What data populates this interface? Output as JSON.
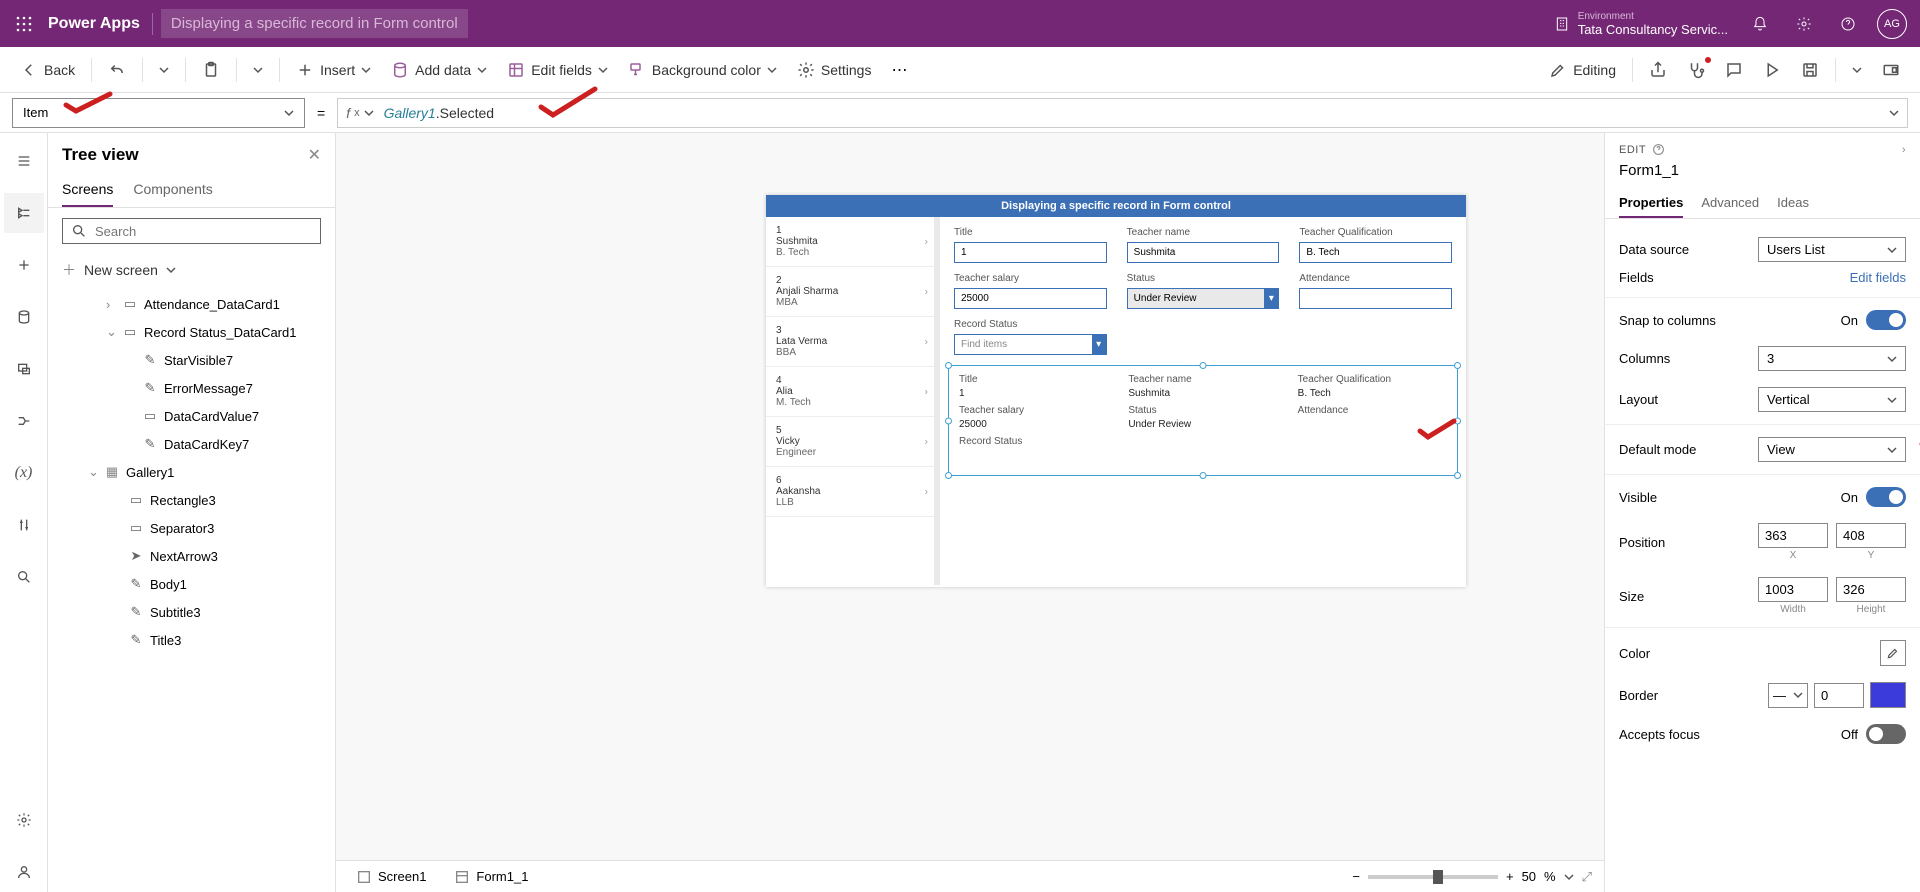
{
  "header": {
    "app": "Power Apps",
    "title": "Displaying a specific record in Form control",
    "env_label": "Environment",
    "env_name": "Tata Consultancy Servic...",
    "avatar": "AG"
  },
  "cmdbar": {
    "back": "Back",
    "insert": "Insert",
    "add_data": "Add data",
    "edit_fields": "Edit fields",
    "bg_color": "Background color",
    "settings": "Settings",
    "editing": "Editing"
  },
  "formula": {
    "property": "Item",
    "fx": "fx",
    "expr_class": "Gallery1",
    "expr_prop": ".Selected"
  },
  "tree": {
    "title": "Tree view",
    "tabs": {
      "screens": "Screens",
      "components": "Components"
    },
    "search_ph": "Search",
    "new_screen": "New screen",
    "items": {
      "attendance": "Attendance_DataCard1",
      "record_status": "Record Status_DataCard1",
      "star": "StarVisible7",
      "error": "ErrorMessage7",
      "dcval": "DataCardValue7",
      "dckey": "DataCardKey7",
      "gallery": "Gallery1",
      "rect": "Rectangle3",
      "sep": "Separator3",
      "next": "NextArrow3",
      "body": "Body1",
      "subtitle": "Subtitle3",
      "title": "Title3"
    }
  },
  "canvas": {
    "title": "Displaying a specific record in Form control",
    "gallery": [
      {
        "id": "1",
        "name": "Sushmita",
        "sub": "B. Tech"
      },
      {
        "id": "2",
        "name": "Anjali Sharma",
        "sub": "MBA"
      },
      {
        "id": "3",
        "name": "Lata Verma",
        "sub": "BBA"
      },
      {
        "id": "4",
        "name": "Alia",
        "sub": "M. Tech"
      },
      {
        "id": "5",
        "name": "Vicky",
        "sub": "Engineer"
      },
      {
        "id": "6",
        "name": "Aakansha",
        "sub": "LLB"
      }
    ],
    "form1": {
      "labels": {
        "title": "Title",
        "tn": "Teacher name",
        "tq": "Teacher Qualification",
        "ts": "Teacher salary",
        "status": "Status",
        "att": "Attendance",
        "rs": "Record Status",
        "find": "Find items"
      },
      "values": {
        "title": "1",
        "tn": "Sushmita",
        "tq": "B. Tech",
        "ts": "25000",
        "status": "Under Review",
        "att": ""
      }
    },
    "form2": {
      "labels": {
        "title": "Title",
        "tn": "Teacher name",
        "tq": "Teacher Qualification",
        "ts": "Teacher salary",
        "status": "Status",
        "att": "Attendance",
        "rs": "Record Status"
      },
      "values": {
        "title": "1",
        "tn": "Sushmita",
        "tq": "B. Tech",
        "ts": "25000",
        "status": "Under Review",
        "att": ""
      }
    }
  },
  "status": {
    "screen1": "Screen1",
    "form11": "Form1_1",
    "zoom": "50",
    "pct": "%"
  },
  "props": {
    "edit": "EDIT",
    "name": "Form1_1",
    "tabs": {
      "prop": "Properties",
      "adv": "Advanced",
      "ideas": "Ideas"
    },
    "data_source_l": "Data source",
    "data_source_v": "Users List",
    "fields_l": "Fields",
    "edit_fields": "Edit fields",
    "snap_l": "Snap to columns",
    "snap_v": "On",
    "cols_l": "Columns",
    "cols_v": "3",
    "layout_l": "Layout",
    "layout_v": "Vertical",
    "mode_l": "Default mode",
    "mode_v": "View",
    "vis_l": "Visible",
    "vis_v": "On",
    "pos_l": "Position",
    "pos_x": "363",
    "pos_y": "408",
    "pos_xl": "X",
    "pos_yl": "Y",
    "size_l": "Size",
    "size_w": "1003",
    "size_h": "326",
    "size_wl": "Width",
    "size_hl": "Height",
    "color_l": "Color",
    "border_l": "Border",
    "border_v": "0",
    "accepts_l": "Accepts focus",
    "accepts_v": "Off"
  }
}
